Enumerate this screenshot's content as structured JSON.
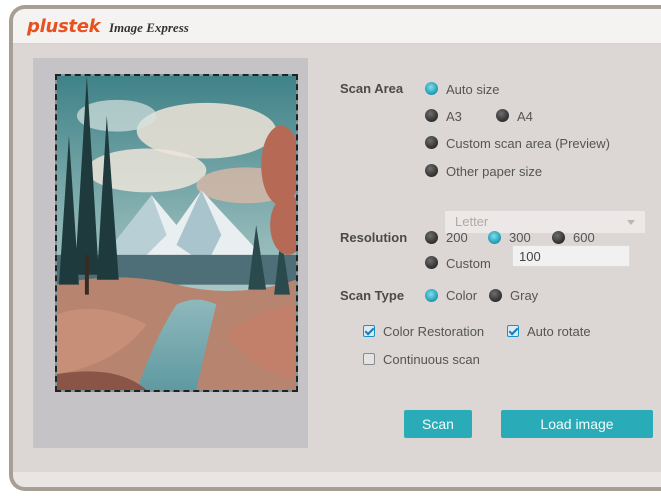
{
  "titlebar": {
    "brand": "plustek",
    "app_name": "Image Express"
  },
  "scan_area": {
    "label": "Scan Area",
    "options": [
      {
        "label": "Auto size",
        "selected": true
      },
      {
        "label": "A3",
        "selected": false
      },
      {
        "label": "A4",
        "selected": false
      },
      {
        "label": "Custom scan area (Preview)",
        "selected": false
      },
      {
        "label": "Other paper size",
        "selected": false
      }
    ],
    "paper_size_select": {
      "value": "Letter"
    }
  },
  "resolution": {
    "label": "Resolution",
    "options": [
      {
        "label": "200",
        "selected": false
      },
      {
        "label": "300",
        "selected": true
      },
      {
        "label": "600",
        "selected": false
      },
      {
        "label": "Custom",
        "selected": false
      }
    ],
    "custom_value": "100"
  },
  "scan_type": {
    "label": "Scan Type",
    "options": [
      {
        "label": "Color",
        "selected": true
      },
      {
        "label": "Gray",
        "selected": false
      }
    ]
  },
  "checkboxes": [
    {
      "label": "Color Restoration",
      "checked": true
    },
    {
      "label": "Auto rotate",
      "checked": true
    },
    {
      "label": "Continuous scan",
      "checked": false
    }
  ],
  "buttons": {
    "scan": "Scan",
    "load_image": "Load image"
  },
  "colors": {
    "accent": "#2aacb8",
    "brand": "#e8511e",
    "radio_selected": "#1d97ad"
  }
}
